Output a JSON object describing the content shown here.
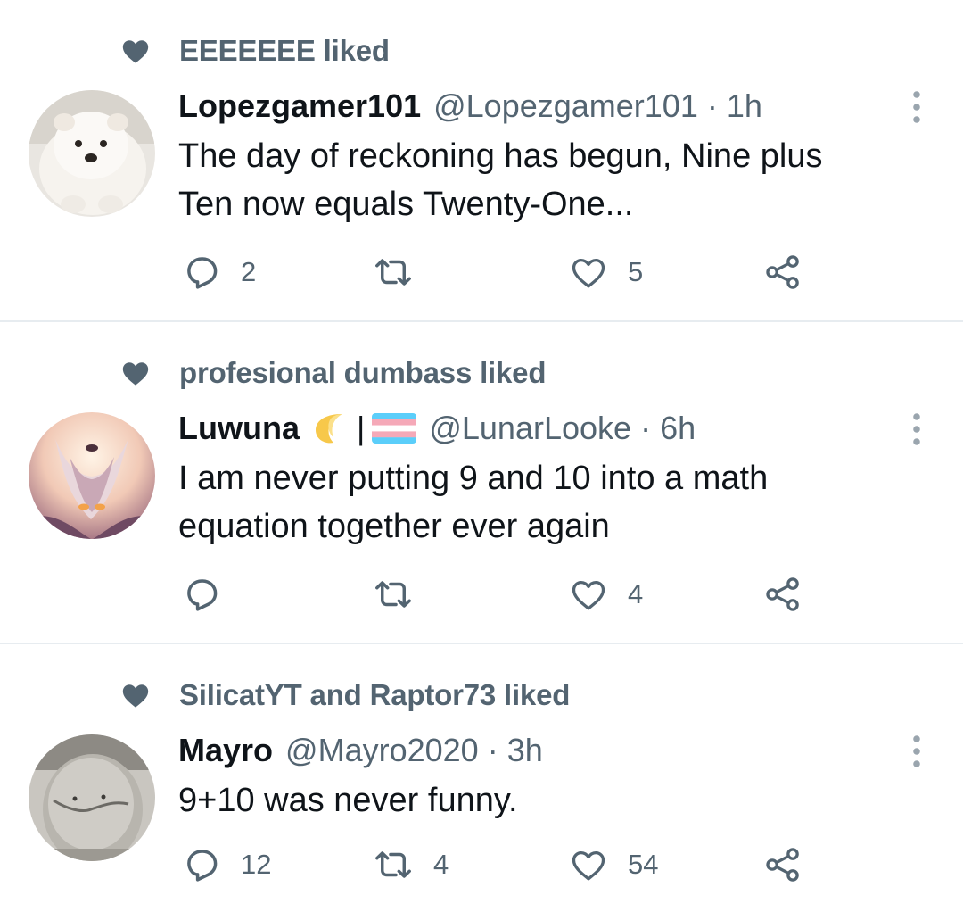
{
  "tweets": [
    {
      "liked_by": "EEEEEEE liked",
      "name": "Lopezgamer101",
      "handle": "@Lopezgamer101",
      "separator": "·",
      "time": "1h",
      "text_line1": "The day of reckoning has begun, Nine plus",
      "text_line2": "Ten now equals Twenty-One...",
      "replies": "2",
      "retweets": "",
      "likes": "5",
      "avatar_icon": "white-dog-avatar"
    },
    {
      "liked_by": "profesional dumbass liked",
      "name": "Luwuna",
      "name_bar": "|",
      "handle": "@LunarLooke",
      "separator": "·",
      "time": "6h",
      "text_line1": "I am never putting 9 and 10 into a math",
      "text_line2": "equation together ever again",
      "replies": "",
      "retweets": "",
      "likes": "4",
      "avatar_icon": "hollow-knight-avatar"
    },
    {
      "liked_by": "SilicatYT and Raptor73 liked",
      "name": "Mayro",
      "handle": "@Mayro2020",
      "separator": "·",
      "time": "3h",
      "text_line1": "9+10 was never funny.",
      "replies": "12",
      "retweets": "4",
      "likes": "54",
      "avatar_icon": "plush-rock-avatar"
    }
  ],
  "colors": {
    "secondary_text": "#536471",
    "primary_text": "#0f1419",
    "divider": "#e7ecf0",
    "trans_blue": "#5bcefa",
    "trans_pink": "#f5a9b8"
  }
}
